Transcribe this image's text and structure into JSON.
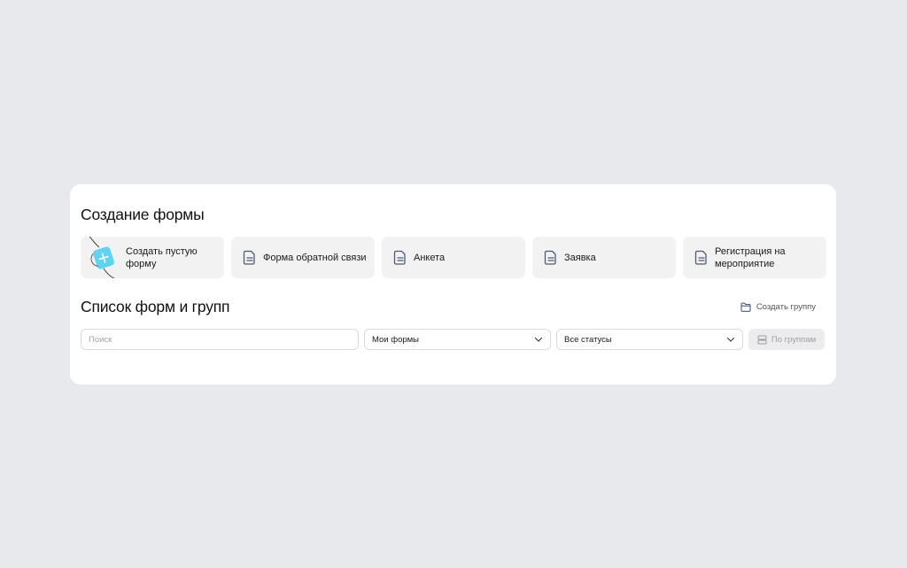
{
  "create_section": {
    "title": "Создание формы",
    "templates": [
      {
        "label": "Создать пустую форму",
        "icon": "blank-form-illustration-icon"
      },
      {
        "label": "Форма обратной связи",
        "icon": "document-icon"
      },
      {
        "label": "Анкета",
        "icon": "document-icon"
      },
      {
        "label": "Заявка",
        "icon": "document-icon"
      },
      {
        "label": "Регистрация на мероприятие",
        "icon": "document-icon"
      }
    ]
  },
  "list_section": {
    "title": "Список форм и групп",
    "create_group_label": "Создать группу",
    "create_group_icon": "folder-icon",
    "search": {
      "placeholder": "Поиск",
      "value": ""
    },
    "owner_filter": {
      "value": "Мои формы"
    },
    "status_filter": {
      "value": "Все статусы"
    },
    "group_toggle_label": "По группам",
    "group_toggle_icon": "rows-icon"
  },
  "colors": {
    "background": "#e8e9ed",
    "panel": "#ffffff",
    "card": "#f2f2f3",
    "illustration_accent": "#5fd3f0",
    "icon_stroke": "#4b5a78"
  }
}
